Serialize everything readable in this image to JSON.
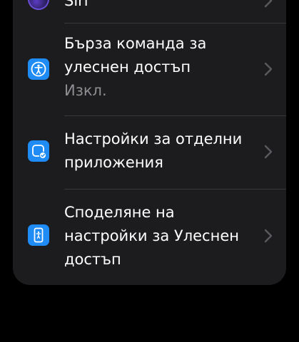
{
  "colors": {
    "background": "#000000",
    "group_background": "#1c1c1e",
    "icon_blue": "#1f8bf5",
    "text_primary": "#ffffff",
    "text_secondary": "#8e8e93",
    "separator": "#38383a",
    "chevron": "#5a5a5e"
  },
  "rows": [
    {
      "label": "Siri",
      "icon": "siri-icon"
    },
    {
      "label": "Бърза команда за улеснен достъп",
      "value": "Изкл.",
      "icon": "accessibility-person-icon"
    },
    {
      "label": "Настройки за отделни приложения",
      "icon": "app-settings-check-icon"
    },
    {
      "label": "Споделяне на настройки за Улеснен достъп",
      "icon": "share-accessibility-phone-icon"
    }
  ]
}
